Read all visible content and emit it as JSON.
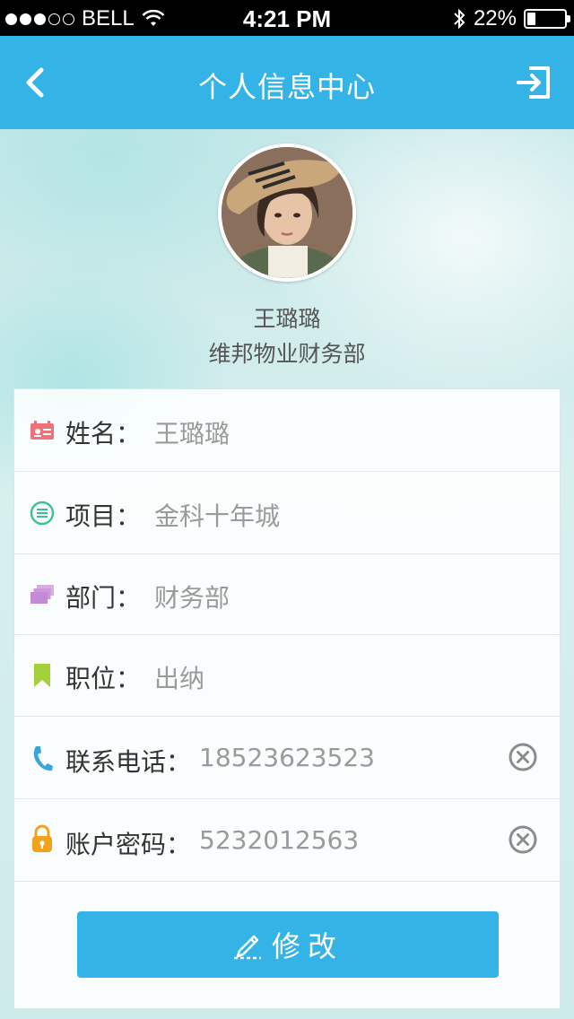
{
  "status_bar": {
    "carrier": "BELL",
    "time": "4:21 PM",
    "battery_percent": "22%",
    "battery_level": 0.22,
    "signal_bars_filled": 3,
    "signal_bars_total": 5
  },
  "nav": {
    "title": "个人信息中心",
    "back_icon": "chevron-left-icon",
    "exit_icon": "sign-out-icon"
  },
  "profile": {
    "name": "王璐璐",
    "department": "维邦物业财务部"
  },
  "fields": [
    {
      "label": "姓名：",
      "value": "王璐璐",
      "icon": "id-card-icon",
      "icon_color": "#f0717a",
      "clearable": false
    },
    {
      "label": "项目：",
      "value": "金科十年城",
      "icon": "list-circle-icon",
      "icon_color": "#3dc28e",
      "clearable": false
    },
    {
      "label": "部门：",
      "value": "财务部",
      "icon": "stack-icon",
      "icon_color": "#c58ad6",
      "clearable": false
    },
    {
      "label": "职位：",
      "value": "出纳",
      "icon": "bookmark-icon",
      "icon_color": "#a4d03c",
      "clearable": false
    },
    {
      "label": "联系电话：",
      "value": "18523623523",
      "icon": "phone-icon",
      "icon_color": "#3ba4e0",
      "clearable": true
    },
    {
      "label": "账户密码：",
      "value": "5232012563",
      "icon": "lock-icon",
      "icon_color": "#f2a31c",
      "clearable": true
    }
  ],
  "submit": {
    "label": "修改",
    "icon": "edit-pencil-icon"
  },
  "colors": {
    "brand": "#33b3e6",
    "label_text": "#333333",
    "value_text": "#9a9a9a"
  }
}
